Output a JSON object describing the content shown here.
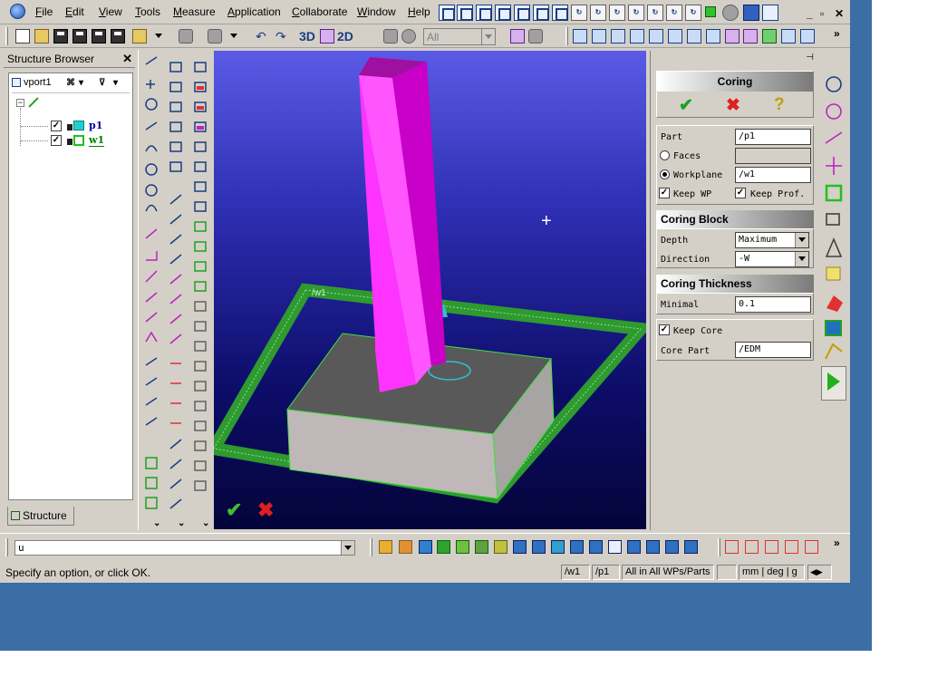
{
  "menu": {
    "items": [
      "File",
      "Edit",
      "View",
      "Tools",
      "Measure",
      "Application",
      "Collaborate",
      "Window",
      "Help"
    ],
    "window_controls": [
      "_",
      "▫",
      "✕"
    ]
  },
  "toolbar": {
    "btn_3d": "3D",
    "btn_2d": "2D",
    "filter_value": "All",
    "overflow": "»"
  },
  "structure_browser": {
    "title": "Structure Browser",
    "viewport_name": "vport1",
    "nodes": [
      {
        "name": "p1",
        "checked": true
      },
      {
        "name": "w1",
        "checked": true
      }
    ],
    "tab_label": "Structure"
  },
  "viewport": {
    "workplane_label": "/w1"
  },
  "coring": {
    "title": "Coring",
    "part_label": "Part",
    "part_value": "/p1",
    "faces_label": "Faces",
    "faces_value": "",
    "workplane_label": "Workplane",
    "workplane_value": "/w1",
    "keep_wp_label": "Keep WP",
    "keep_prof_label": "Keep Prof.",
    "block_title": "Coring Block",
    "depth_label": "Depth",
    "depth_value": "Maximum",
    "direction_label": "Direction",
    "direction_value": "-W",
    "thickness_title": "Coring Thickness",
    "minimal_label": "Minimal",
    "minimal_value": "0.1",
    "keep_core_label": "Keep Core",
    "core_part_label": "Core Part",
    "core_part_value": "/EDM"
  },
  "command": {
    "input_value": "u"
  },
  "status": {
    "message": "Specify an option, or click OK.",
    "wp": "/w1",
    "part": "/p1",
    "scope": "All in All WPs/Parts",
    "units": "mm | deg | g"
  },
  "colors": {
    "part_magenta": "#ff33ff",
    "ok_green": "#3fbf2f",
    "cancel_red": "#e02020",
    "workplane_green": "#2f9a2f"
  }
}
